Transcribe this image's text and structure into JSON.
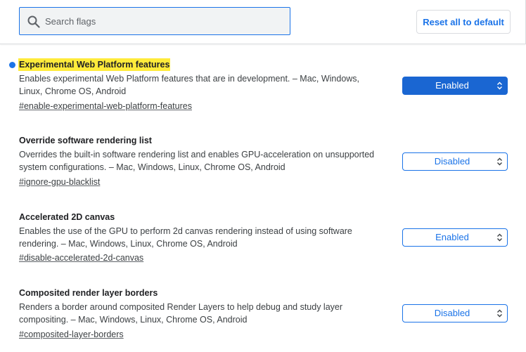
{
  "search": {
    "placeholder": "Search flags",
    "value": ""
  },
  "header": {
    "reset_label": "Reset all to default"
  },
  "colors": {
    "accent": "#1a73e8",
    "highlight": "#ffeb3b",
    "modified_dot": "#1a73e8"
  },
  "icons": {
    "search": "search-icon",
    "select_arrows": "chevron-updown-icon",
    "modified": "modified-dot-icon"
  },
  "flags": [
    {
      "title": "Experimental Web Platform features",
      "highlighted": true,
      "modified": true,
      "desc_line1": "Enables experimental Web Platform features that are in development. – Mac, Windows,",
      "desc_line2": "Linux, Chrome OS, Android",
      "link": "#enable-experimental-web-platform-features",
      "state": "Enabled"
    },
    {
      "title": "Override software rendering list",
      "highlighted": false,
      "modified": false,
      "desc_line1": "Overrides the built-in software rendering list and enables GPU-acceleration on unsupported",
      "desc_line2": "system configurations. – Mac, Windows, Linux, Chrome OS, Android",
      "link": "#ignore-gpu-blacklist",
      "state": "Disabled"
    },
    {
      "title": "Accelerated 2D canvas",
      "highlighted": false,
      "modified": false,
      "desc_line1": "Enables the use of the GPU to perform 2d canvas rendering instead of using software",
      "desc_line2": "rendering. – Mac, Windows, Linux, Chrome OS, Android",
      "link": "#disable-accelerated-2d-canvas",
      "state": "Enabled"
    },
    {
      "title": "Composited render layer borders",
      "highlighted": false,
      "modified": false,
      "desc_line1": "Renders a border around composited Render Layers to help debug and study layer",
      "desc_line2": "compositing. – Mac, Windows, Linux, Chrome OS, Android",
      "link": "#composited-layer-borders",
      "state": "Disabled"
    }
  ]
}
